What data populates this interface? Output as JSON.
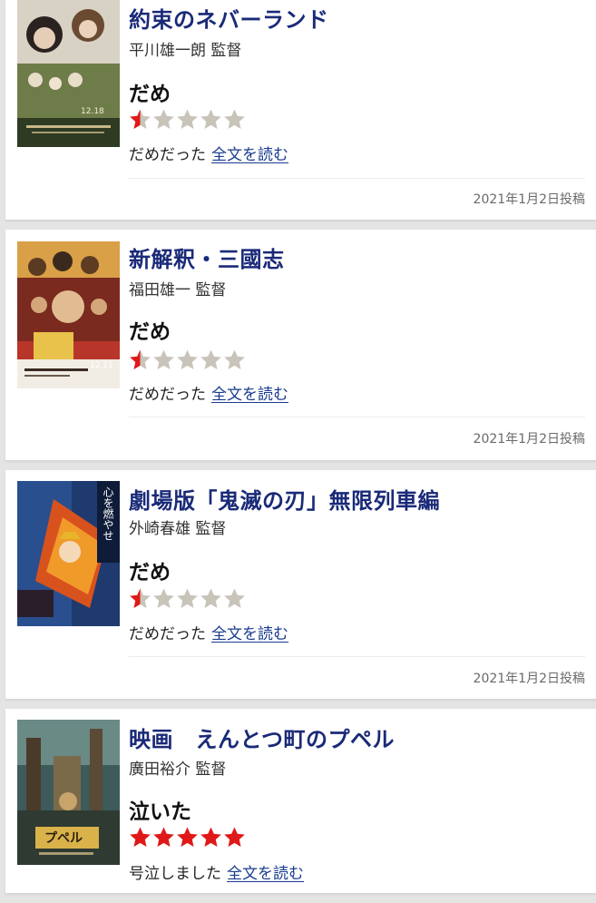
{
  "reviews": [
    {
      "title": "約束のネバーランド",
      "director": "平川雄一朗 監督",
      "verdict": "だめ",
      "rating": 0.5,
      "rating_max": 5,
      "snippet": "だめだった",
      "read_more": "全文を読む",
      "date": "2021年1月2日投稿",
      "poster_text": "12.18"
    },
    {
      "title": "新解釈・三國志",
      "director": "福田雄一 監督",
      "verdict": "だめ",
      "rating": 0.5,
      "rating_max": 5,
      "snippet": "だめだった",
      "read_more": "全文を読む",
      "date": "2021年1月2日投稿",
      "poster_text": "12.11"
    },
    {
      "title": "劇場版「鬼滅の刃」無限列車編",
      "director": "外崎春雄 監督",
      "verdict": "だめ",
      "rating": 0.5,
      "rating_max": 5,
      "snippet": "だめだった",
      "read_more": "全文を読む",
      "date": "2021年1月2日投稿",
      "poster_text": "心を燃やせ"
    },
    {
      "title": "映画　えんとつ町のプペル",
      "director": "廣田裕介 監督",
      "verdict": "泣いた",
      "rating": 5,
      "rating_max": 5,
      "snippet": "号泣しました",
      "read_more": "全文を読む",
      "date": "",
      "poster_text": "プペル"
    }
  ],
  "colors": {
    "title": "#1a2a78",
    "star_filled": "#e01818",
    "star_empty": "#c9c4ba",
    "link": "#1a3c8f"
  }
}
